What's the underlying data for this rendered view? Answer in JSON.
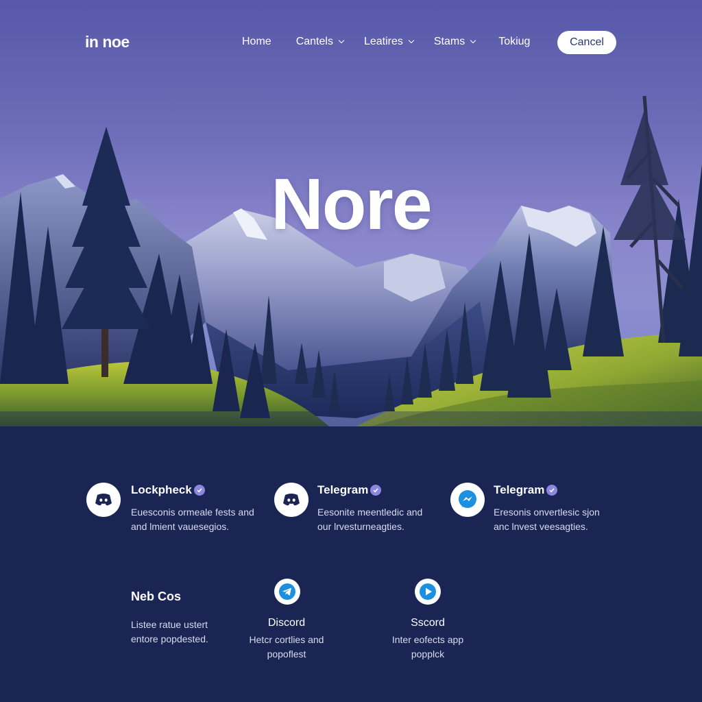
{
  "nav": {
    "logo": "in noe",
    "links": [
      {
        "label": "Home"
      },
      {
        "label": "Cantels"
      },
      {
        "label": "Leatires"
      },
      {
        "label": "Stams"
      },
      {
        "label": "Tokiug"
      }
    ],
    "cancel_label": "Cancel"
  },
  "hero": {
    "title": "Nore"
  },
  "features": [
    {
      "title": "Lockpheck",
      "icon": "discord-icon",
      "line1": "Euesconis ormeale fests and",
      "line2": "and lmient vauesegios."
    },
    {
      "title": "Telegram",
      "icon": "discord-icon",
      "line1": "Eesonite meentledic and",
      "line2": "our lrvesturneagties."
    },
    {
      "title": "Telegram",
      "icon": "messenger-icon",
      "line1": "Eresonis onvertlesic sjon",
      "line2": "anc lnvest veesagties."
    }
  ],
  "bottom": [
    {
      "title": "Neb Cos",
      "line1": "Listee ratue ustert",
      "line2": "entore popdested."
    },
    {
      "title": "Discord",
      "icon": "telegram-icon",
      "line1": "Hetcr cortlies and",
      "line2": "popoflest"
    },
    {
      "title": "Sscord",
      "icon": "play-icon",
      "line1": "Inter eofects app",
      "line2": "popplck"
    }
  ],
  "colors": {
    "page_bg": "#1a2554",
    "accent": "#8b86e0",
    "button_text": "#2d3570",
    "icon_blue": "#1d8fe0"
  }
}
